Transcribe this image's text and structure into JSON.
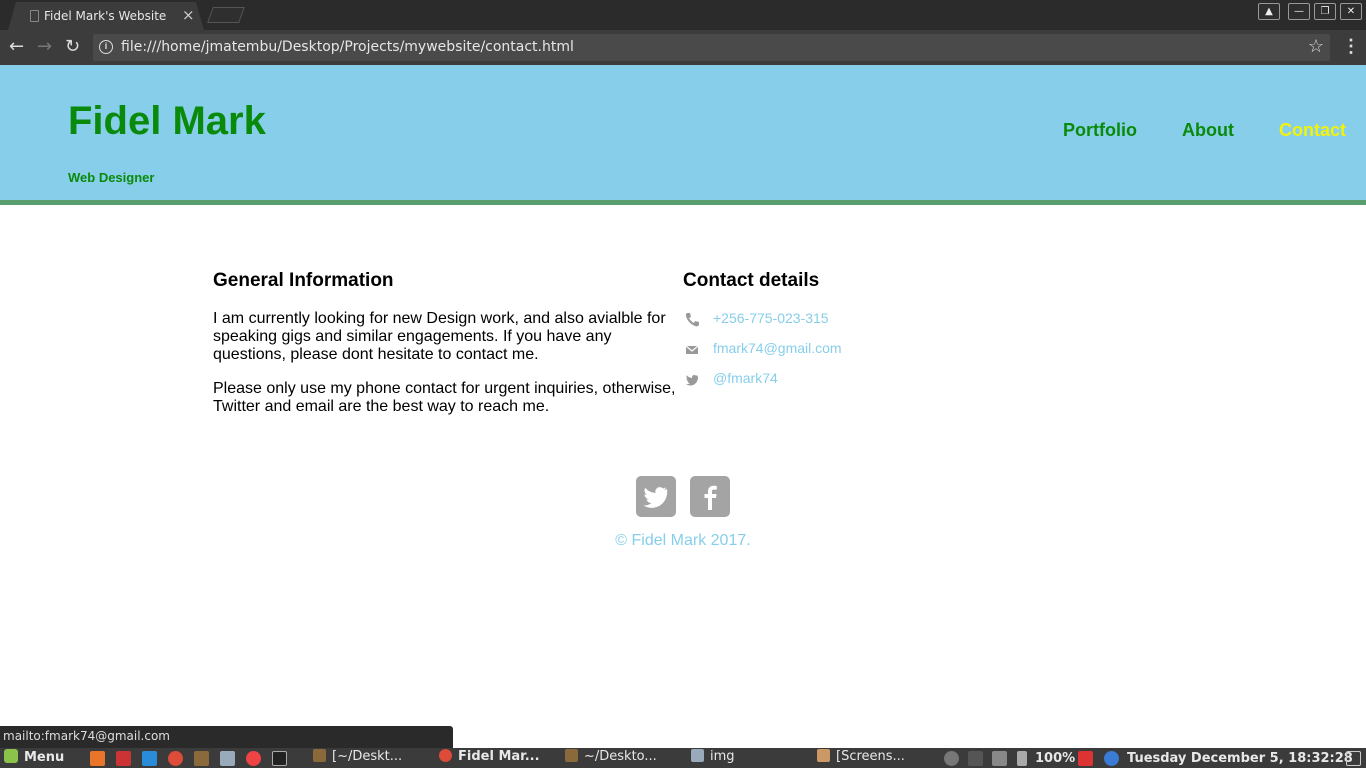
{
  "browser": {
    "tab_title": "Fidel Mark's Website",
    "tab_close": "×",
    "url": "file:///home/jmatembu/Desktop/Projects/mywebsite/contact.html",
    "status_text": "mailto:fmark74@gmail.com"
  },
  "header": {
    "title": "Fidel Mark",
    "subtitle": "Web Designer",
    "nav": {
      "portfolio": "Portfolio",
      "about": "About",
      "contact": "Contact"
    },
    "colors": {
      "background": "#87ceeb",
      "text": "#0a8a0a",
      "active": "#f2f20a"
    }
  },
  "general": {
    "heading": "General Information",
    "para1": "I am currently looking for new Design work, and also avialble for speaking gigs and similar engagements. If you have any questions, please dont hesitate to contact me.",
    "para2": "Please only use my phone contact for urgent inquiries, otherwise, Twitter and email are the best way to reach me."
  },
  "contact": {
    "heading": "Contact details",
    "phone": "+256-775-023-315",
    "email": "fmark74@gmail.com",
    "twitter": "@fmark74"
  },
  "footer": {
    "social_icons": [
      "twitter-icon",
      "facebook-icon"
    ],
    "copyright": "© Fidel Mark 2017."
  },
  "taskbar": {
    "menu_label": "Menu",
    "tasks": [
      "[~/Deskt...",
      "Fidel Mar...",
      "~/Deskto...",
      "img",
      "[Screens..."
    ],
    "battery": "100%",
    "clock": "Tuesday December  5, 18:32:28"
  }
}
